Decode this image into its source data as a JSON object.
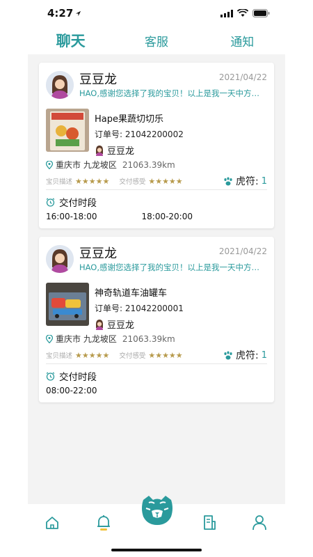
{
  "status_bar": {
    "time": "4:27"
  },
  "tabs": [
    {
      "label": "聊天",
      "active": true
    },
    {
      "label": "客服",
      "active": false
    },
    {
      "label": "通知",
      "active": false
    }
  ],
  "rating_labels": {
    "description": "宝贝描述",
    "delivery": "交付感受"
  },
  "stars": "★★★★★",
  "hufu_label": "虎符:",
  "delivery_title": "交付时段",
  "cards": [
    {
      "shop_name": "豆豆龙",
      "date": "2021/04/22",
      "message": "HAO,感谢您选择了我的宝贝！以上是我一天中方便交付的时段",
      "product_name": "Hape果蔬切切乐",
      "order_no": "订单号: 21042200002",
      "seller_name": "豆豆龙",
      "location": "重庆市 九龙坡区",
      "distance": "21063.39km",
      "hufu": "1",
      "slots": [
        "16:00-18:00",
        "18:00-20:00"
      ]
    },
    {
      "shop_name": "豆豆龙",
      "date": "2021/04/22",
      "message": "HAO,感谢您选择了我的宝贝！以上是我一天中方便交付的时段",
      "product_name": "神奇轨道车油罐车",
      "order_no": "订单号: 21042200001",
      "seller_name": "豆豆龙",
      "location": "重庆市 九龙坡区",
      "distance": "21063.39km",
      "hufu": "1",
      "slots": [
        "08:00-22:00"
      ]
    }
  ],
  "colors": {
    "accent": "#2a9a9c",
    "star": "#b79a4c",
    "background": "#f3f3f3"
  },
  "nav_icons": [
    "home-icon",
    "bell-icon",
    "tiger-logo",
    "order-icon",
    "user-icon"
  ]
}
